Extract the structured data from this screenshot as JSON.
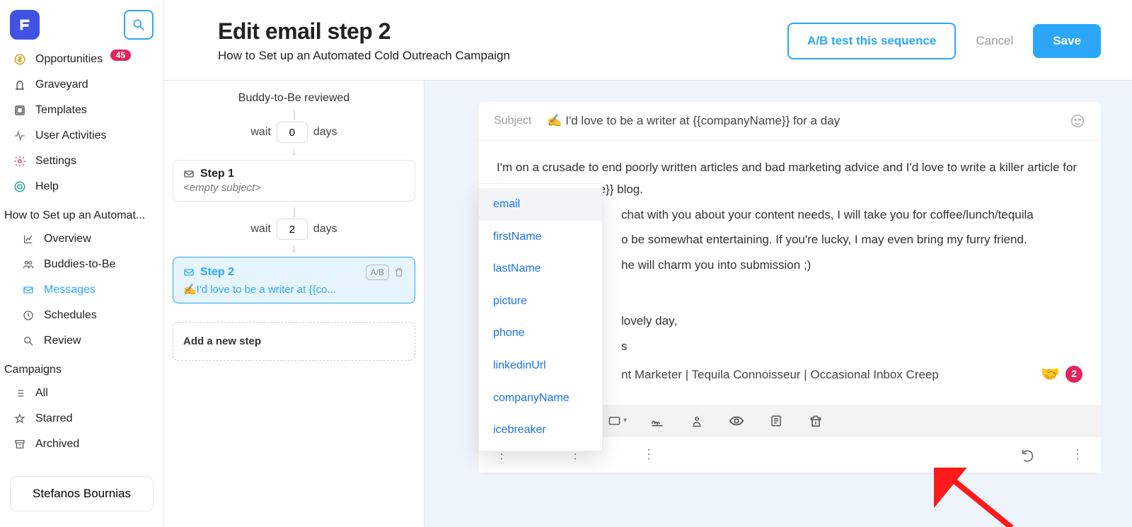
{
  "sidebar": {
    "nav": [
      {
        "icon": "dollar-icon",
        "label": "Opportunities",
        "badge": "45"
      },
      {
        "icon": "graveyard-icon",
        "label": "Graveyard"
      },
      {
        "icon": "templates-icon",
        "label": "Templates"
      },
      {
        "icon": "activity-icon",
        "label": "User Activities"
      },
      {
        "icon": "gear-icon",
        "label": "Settings"
      },
      {
        "icon": "help-icon",
        "label": "Help"
      }
    ],
    "campaign_title": "How to Set up an Automat...",
    "campaign_items": [
      {
        "icon": "chart-icon",
        "label": "Overview"
      },
      {
        "icon": "people-icon",
        "label": "Buddies-to-Be"
      },
      {
        "icon": "mail-icon",
        "label": "Messages",
        "active": true
      },
      {
        "icon": "clock-icon",
        "label": "Schedules"
      },
      {
        "icon": "search-icon",
        "label": "Review"
      }
    ],
    "campaigns_label": "Campaigns",
    "campaigns_items": [
      {
        "icon": "list-icon",
        "label": "All"
      },
      {
        "icon": "star-icon",
        "label": "Starred"
      },
      {
        "icon": "archive-icon",
        "label": "Archived"
      }
    ],
    "user": "Stefanos Bournias"
  },
  "header": {
    "title": "Edit email step 2",
    "subtitle": "How to Set up an Automated Cold Outreach Campaign",
    "ab_test": "A/B test this sequence",
    "cancel": "Cancel",
    "save": "Save"
  },
  "steps_col": {
    "reviewed": "Buddy-to-Be reviewed",
    "wait_label_pre": "wait",
    "wait_label_post": "days",
    "wait1": "0",
    "wait2": "2",
    "step1_title": "Step 1",
    "step1_sub": "<empty subject>",
    "step2_title": "Step 2",
    "step2_sub": "✍️I'd love to be a writer at {{co...",
    "ab_chip": "A/B",
    "add_step": "Add a new step"
  },
  "editor": {
    "subject_label": "Subject",
    "subject_text": "✍️ I'd love to be a writer at {{companyName}} for a day",
    "body": {
      "p1": "I'm on a crusade to end poorly written articles and bad marketing advice and I'd love to write a killer article for the {{companyName}} blog.",
      "p2_tail": "chat with you about your content needs, I will take you for coffee/lunch/tequila",
      "p3_tail": "o be somewhat entertaining. If you're lucky, I may even bring my furry friend.",
      "p4_tail": "he will charm you into submission ;)",
      "sign1": "lovely day,",
      "sign2": "s",
      "sig_line_tail": "nt Marketer | Tequila Connoisseur | Occasional Inbox Creep"
    },
    "handshake_emoji": "🤝",
    "sig_count": "2",
    "var_options": [
      "email",
      "firstName",
      "lastName",
      "picture",
      "phone",
      "linkedinUrl",
      "companyName",
      "icebreaker"
    ]
  }
}
